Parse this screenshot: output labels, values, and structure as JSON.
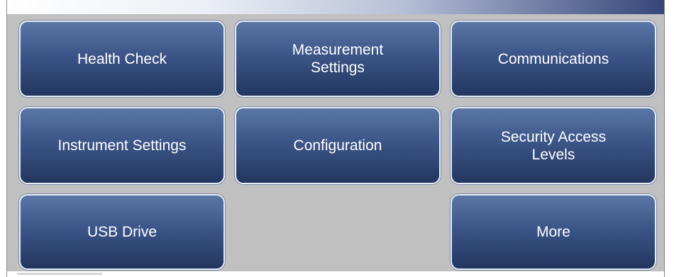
{
  "menu": {
    "health_check": "Health Check",
    "measurement_settings": "Measurement Settings",
    "communications": "Communications",
    "instrument_settings": "Instrument Settings",
    "configuration": "Configuration",
    "security_access_levels": "Security Access Levels",
    "usb_drive": "USB Drive",
    "more": "More"
  },
  "colors": {
    "panel_background": "#c0c0c0",
    "button_top": "#5a76a6",
    "button_bottom": "#22365f",
    "title_bar_end": "#34467a"
  }
}
